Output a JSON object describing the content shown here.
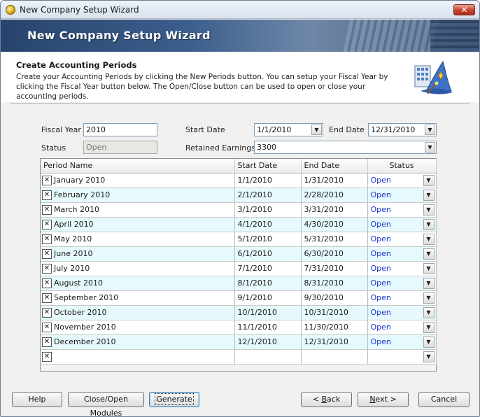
{
  "window": {
    "title": "New Company Setup Wizard",
    "close_glyph": "✕"
  },
  "banner": {
    "title": "New Company Setup Wizard"
  },
  "header": {
    "title": "Create Accounting Periods",
    "description": "Create your Accounting Periods by clicking the New Periods button. You can setup your Fiscal Year by clicking the Fiscal Year button below. The Open/Close button can be used to open or close your accounting periods.",
    "icon": "wizard-building-icon"
  },
  "form": {
    "fiscal_year_label": "Fiscal Year",
    "fiscal_year_value": "2010",
    "status_label": "Status",
    "status_value": "Open",
    "start_date_label": "Start Date",
    "start_date_value": "1/1/2010",
    "end_date_label": "End Date",
    "end_date_value": "12/31/2010",
    "retained_earnings_label": "Retained Earnings",
    "retained_earnings_value": "3300"
  },
  "grid": {
    "columns": [
      "Period Name",
      "Start Date",
      "End Date",
      "Status"
    ],
    "rows": [
      {
        "name": "January 2010",
        "start": "1/1/2010",
        "end": "1/31/2010",
        "status": "Open"
      },
      {
        "name": "February 2010",
        "start": "2/1/2010",
        "end": "2/28/2010",
        "status": "Open"
      },
      {
        "name": "March 2010",
        "start": "3/1/2010",
        "end": "3/31/2010",
        "status": "Open"
      },
      {
        "name": "April 2010",
        "start": "4/1/2010",
        "end": "4/30/2010",
        "status": "Open"
      },
      {
        "name": "May 2010",
        "start": "5/1/2010",
        "end": "5/31/2010",
        "status": "Open"
      },
      {
        "name": "June 2010",
        "start": "6/1/2010",
        "end": "6/30/2010",
        "status": "Open"
      },
      {
        "name": "July 2010",
        "start": "7/1/2010",
        "end": "7/31/2010",
        "status": "Open"
      },
      {
        "name": "August 2010",
        "start": "8/1/2010",
        "end": "8/31/2010",
        "status": "Open"
      },
      {
        "name": "September 2010",
        "start": "9/1/2010",
        "end": "9/30/2010",
        "status": "Open"
      },
      {
        "name": "October 2010",
        "start": "10/1/2010",
        "end": "10/31/2010",
        "status": "Open"
      },
      {
        "name": "November 2010",
        "start": "11/1/2010",
        "end": "11/30/2010",
        "status": "Open"
      },
      {
        "name": "December 2010",
        "start": "12/1/2010",
        "end": "12/31/2010",
        "status": "Open"
      }
    ]
  },
  "buttons": {
    "help": "Help",
    "modules": "Close/Open Modules",
    "generate": "Generate",
    "back_prefix": "< ",
    "back_key": "B",
    "back_rest": "ack",
    "next_key": "N",
    "next_rest": "ext >",
    "cancel": "Cancel"
  },
  "colors": {
    "status_link": "#1a33cc",
    "row_alt": "#e6fafd",
    "banner": "#27446d"
  }
}
